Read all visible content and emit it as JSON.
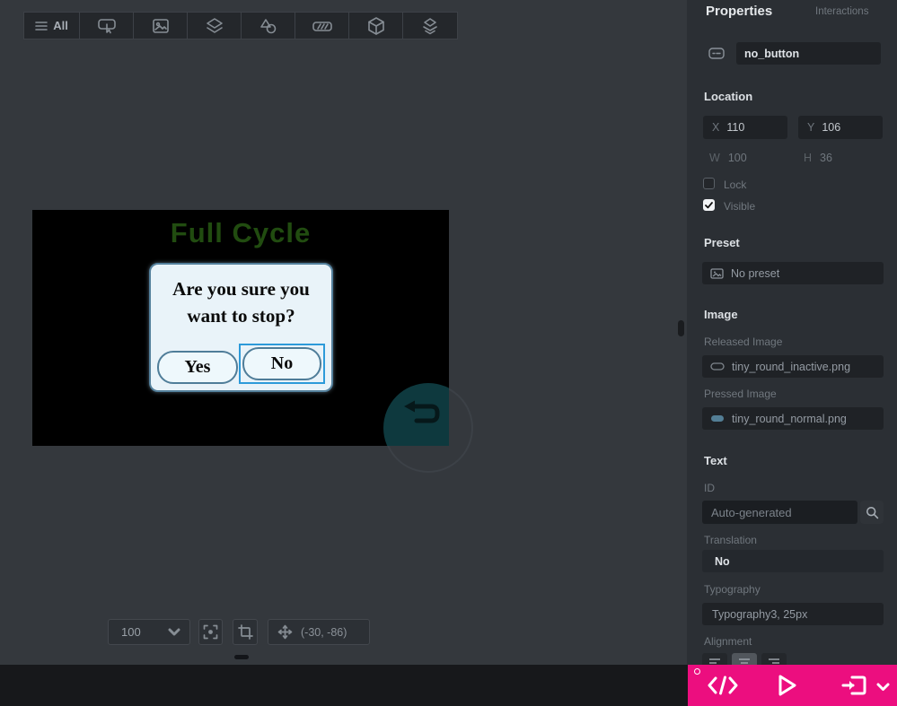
{
  "colors": {
    "accent_pink": "#ec0e7f",
    "selection_blue": "#2d9ad9",
    "screen_title_green": "#214c10",
    "dialog_bg": "#e9f3f9",
    "dialog_border": "#54809c",
    "reset_button_teal": "#0e393e",
    "canvas_bg": "#34383d",
    "panel_bg": "#2b2f34",
    "field_bg": "#1f2226"
  },
  "widget_toolbar": {
    "all_label": "All"
  },
  "screen": {
    "title": "Full Cycle",
    "dialog": {
      "message_line1": "Are you sure you",
      "message_line2": "want to stop?",
      "yes_label": "Yes",
      "no_label": "No"
    }
  },
  "zoom_toolbar": {
    "zoom_level": "100",
    "pan_coords": "(-30, -86)"
  },
  "panel": {
    "tab_properties": "Properties",
    "tab_interactions": "Interactions",
    "widget_name": "no_button",
    "location": {
      "heading": "Location",
      "x_label": "X",
      "x_value": "110",
      "y_label": "Y",
      "y_value": "106",
      "w_label": "W",
      "w_value": "100",
      "h_label": "H",
      "h_value": "36",
      "lock_label": "Lock",
      "visible_label": "Visible"
    },
    "preset": {
      "heading": "Preset",
      "value": "No preset"
    },
    "image": {
      "heading": "Image",
      "released_label": "Released Image",
      "released_value": "tiny_round_inactive.png",
      "pressed_label": "Pressed Image",
      "pressed_value": "tiny_round_normal.png"
    },
    "text": {
      "heading": "Text",
      "id_label": "ID",
      "id_placeholder": "Auto-generated",
      "translation_label": "Translation",
      "translation_value": "No",
      "typography_label": "Typography",
      "typography_value": "Typography3, 25px",
      "alignment_label": "Alignment"
    }
  }
}
